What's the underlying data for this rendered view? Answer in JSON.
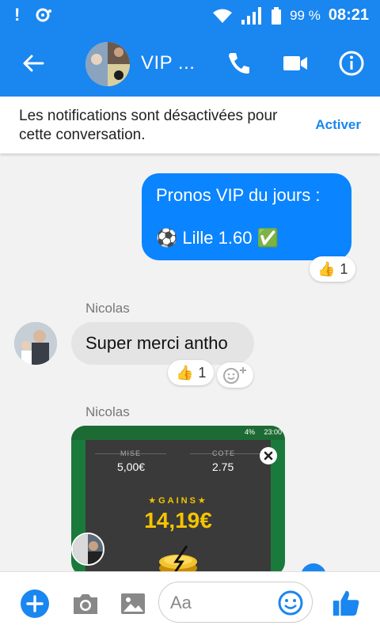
{
  "statusbar": {
    "battery_pct": "99 %",
    "time": "08:21"
  },
  "header": {
    "title": "VIP ...",
    "icons": [
      "back-arrow-icon",
      "phone-icon",
      "video-camera-icon",
      "info-icon"
    ]
  },
  "notice": {
    "text": "Les notifications sont désactivées pour cette conversation.",
    "action": "Activer"
  },
  "messages": [
    {
      "direction": "outgoing",
      "line1": "Pronos VIP du jours :",
      "line2_emoji": "⚽",
      "line2_text": "Lille 1.60",
      "line2_suffix": "✅",
      "reaction": {
        "emoji": "👍",
        "count": "1"
      }
    },
    {
      "direction": "incoming",
      "sender": "Nicolas",
      "text": "Super merci antho",
      "reaction": {
        "emoji": "👍",
        "count": "1"
      }
    },
    {
      "direction": "incoming",
      "sender": "Nicolas",
      "type": "image",
      "image": {
        "status_time": "23:00",
        "status_battery": "4%",
        "mise_label": "MISE",
        "mise_value": "5,00€",
        "cote_label": "COTE",
        "cote_value": "2.75",
        "gains_label": "★GAINS★",
        "gains_value": "14,19€"
      }
    }
  ],
  "composer": {
    "placeholder": "Aa"
  },
  "colors": {
    "brand": "#1a86f0",
    "bubble_out": "#0a84ff",
    "bubble_in": "#e4e4e4",
    "gold": "#f5c400"
  }
}
